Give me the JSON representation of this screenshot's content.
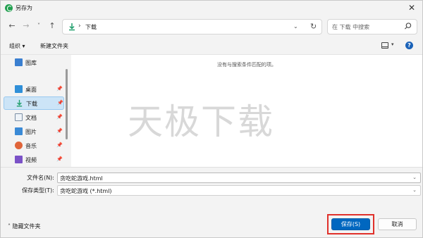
{
  "window": {
    "title": "另存为"
  },
  "nav": {
    "back": "←",
    "forward": "→",
    "recent": "˅",
    "up": "↑",
    "path_sep": "›",
    "path": "下载",
    "path_dropdown": "⌄",
    "refresh": "↻",
    "search_placeholder": "在 下载 中搜索"
  },
  "toolbar": {
    "organize": "组织 ▾",
    "new_folder": "新建文件夹",
    "view_dropdown": "▾",
    "help": "?"
  },
  "sidebar": {
    "items": [
      {
        "label": "图库",
        "icon": "gallery-icon",
        "pinned": false
      },
      {
        "label": "桌面",
        "icon": "desktop-icon",
        "pinned": true
      },
      {
        "label": "下载",
        "icon": "download-icon",
        "pinned": true,
        "selected": true
      },
      {
        "label": "文档",
        "icon": "document-icon",
        "pinned": true
      },
      {
        "label": "图片",
        "icon": "pictures-icon",
        "pinned": true
      },
      {
        "label": "音乐",
        "icon": "music-icon",
        "pinned": true
      },
      {
        "label": "视频",
        "icon": "video-icon",
        "pinned": true
      }
    ],
    "pin_glyph": "📌"
  },
  "content": {
    "empty_message": "没有与搜索条件匹配的项。",
    "watermark": "天极下载"
  },
  "form": {
    "filename_label": "文件名(N):",
    "filename_value": "贪吃蛇游戏.html",
    "type_label": "保存类型(T):",
    "type_value": "贪吃蛇游戏 (*.html)"
  },
  "footer": {
    "hide_folders": "隐藏文件夹",
    "save": "保存(S)",
    "cancel": "取消"
  },
  "colors": {
    "accent": "#0067c0",
    "highlight": "#e0312b",
    "selected_bg": "#cce4f7"
  }
}
